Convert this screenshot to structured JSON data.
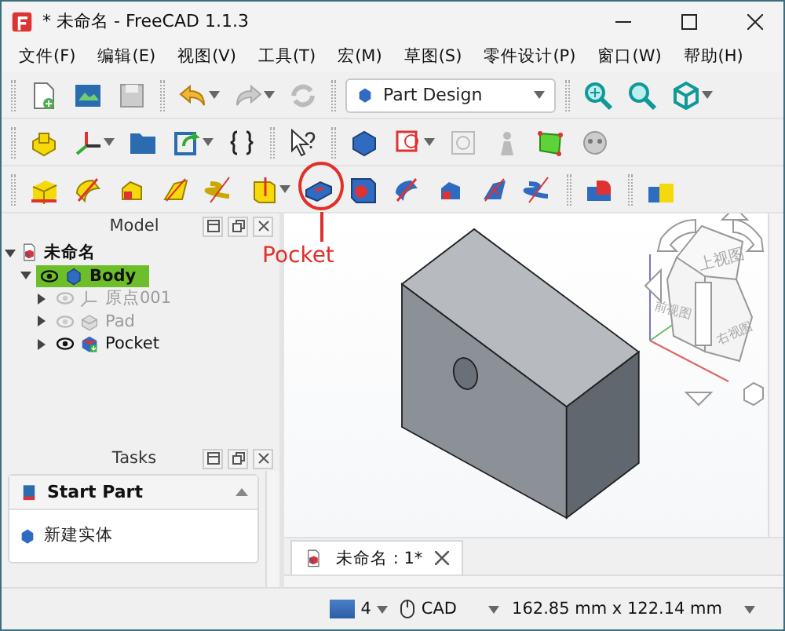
{
  "window": {
    "title": "* 未命名 - FreeCAD 1.1.3"
  },
  "menu": [
    "文件(F)",
    "编辑(E)",
    "视图(V)",
    "工具(T)",
    "宏(M)",
    "草图(S)",
    "零件设计(P)",
    "窗口(W)",
    "帮助(H)"
  ],
  "workbench": {
    "value": "Part Design"
  },
  "annotation": {
    "label": "Pocket"
  },
  "model_panel": {
    "title": "Model",
    "tree": [
      {
        "label": "未命名",
        "kind": "document",
        "expanded": true,
        "children": [
          {
            "label": "Body",
            "kind": "body",
            "selected": true,
            "visible": true,
            "expanded": true,
            "children": [
              {
                "label": "原点001",
                "kind": "origin",
                "selected": false,
                "visible": false,
                "expanded": false
              },
              {
                "label": "Pad",
                "kind": "pad",
                "selected": false,
                "visible": false,
                "expanded": false
              },
              {
                "label": "Pocket",
                "kind": "pocket",
                "selected": false,
                "visible": true,
                "expanded": false
              }
            ]
          }
        ]
      }
    ]
  },
  "tasks_panel": {
    "title": "Tasks",
    "section": {
      "title": "Start Part",
      "expanded": true,
      "items": [
        "新建实体"
      ]
    }
  },
  "nav_cube": {
    "faces": [
      "上视图",
      "前视图",
      "右视图"
    ]
  },
  "document_tabs": [
    {
      "label": "未命名 : 1*",
      "selected": true
    }
  ],
  "status_bar": {
    "count": "4",
    "nav_style": "CAD",
    "dimensions": "162.85 mm x 122.14 mm"
  }
}
